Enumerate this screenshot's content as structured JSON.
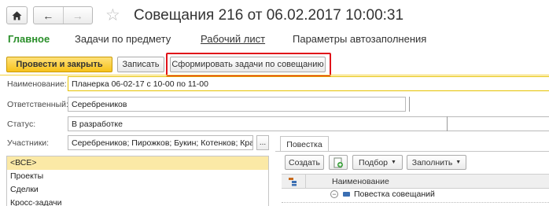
{
  "window": {
    "title": "Совещания 216 от 06.02.2017 10:00:31"
  },
  "sections": [
    {
      "label": "Главное",
      "active": true
    },
    {
      "label": "Задачи по предмету"
    },
    {
      "label": "Рабочий лист"
    },
    {
      "label": "Параметры автозаполнения"
    }
  ],
  "commands": {
    "post_close": "Провести и закрыть",
    "save": "Записать",
    "form_tasks": "Сформировать задачи по совещанию"
  },
  "form": {
    "name_label": "Наименование:",
    "name_value": "Планерка 06-02-17 с 10-00 по 11-00",
    "responsible_label": "Ответственный:",
    "responsible_value": "Серебреников",
    "status_label": "Статус:",
    "status_value": "В разработке",
    "participants_label": "Участники:",
    "participants_value": "Серебреников; Пирожков; Букин; Котенков; Кра",
    "participants_more": "..."
  },
  "left_list": {
    "items": [
      {
        "label": "<ВСЕ>",
        "selected": true
      },
      {
        "label": "Проекты"
      },
      {
        "label": "Сделки"
      },
      {
        "label": "Кросс-задачи"
      }
    ]
  },
  "agenda": {
    "tab_label": "Повестка",
    "create_button": "Создать",
    "pick_button": "Подбор",
    "fill_button": "Заполнить",
    "column_name": "Наименование",
    "rows": [
      {
        "label": "Повестка совещаний"
      }
    ]
  },
  "colors": {
    "accent_green": "#2a8f2a",
    "primary_button": "#f7c21a",
    "highlight_red": "#e0131a",
    "selected_row": "#fbe9a6"
  }
}
